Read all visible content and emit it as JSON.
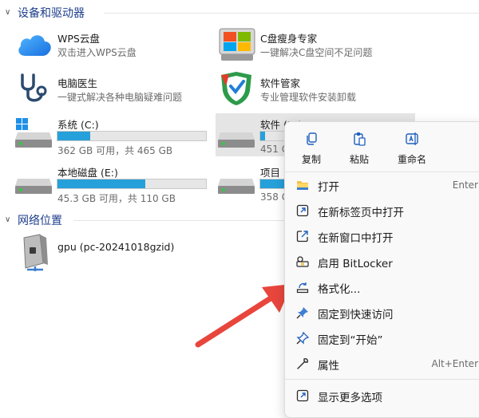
{
  "sections": {
    "devices": "设备和驱动器",
    "network": "网络位置"
  },
  "apps": [
    {
      "title": "WPS云盘",
      "subtitle": "双击进入WPS云盘",
      "icon": "cloud-icon"
    },
    {
      "title": "C盘瘦身专家",
      "subtitle": "一键解决C盘空间不足问题",
      "icon": "disk-cleaner-icon"
    },
    {
      "title": "电脑医生",
      "subtitle": "一键式解决各种电脑疑难问题",
      "icon": "stethoscope-icon"
    },
    {
      "title": "软件管家",
      "subtitle": "专业管理软件安装卸载",
      "icon": "software-manager-icon"
    }
  ],
  "drives": [
    {
      "label": "系统 (C:)",
      "usage": "362 GB 可用，共 465 GB",
      "used_fraction": 0.22
    },
    {
      "label": "软件 (D:)",
      "usage": "451 G",
      "used_fraction": 0.03
    },
    {
      "label": "本地磁盘 (E:)",
      "usage": "45.3 GB 可用，共 110 GB",
      "used_fraction": 0.59
    },
    {
      "label": "项目",
      "usage": "358 G",
      "used_fraction": 0.2
    }
  ],
  "network": {
    "label": "gpu (pc-20241018gzid)",
    "icon": "network-drive-icon"
  },
  "context_menu": {
    "quick_actions": [
      {
        "label": "复制",
        "icon": "copy-icon"
      },
      {
        "label": "粘贴",
        "icon": "paste-icon"
      },
      {
        "label": "重命名",
        "icon": "rename-icon"
      }
    ],
    "items": [
      {
        "label": "打开",
        "shortcut": "Enter",
        "icon": "folder-icon"
      },
      {
        "label": "在新标签页中打开",
        "shortcut": "",
        "icon": "new-tab-icon"
      },
      {
        "label": "在新窗口中打开",
        "shortcut": "",
        "icon": "new-window-icon"
      },
      {
        "label": "启用 BitLocker",
        "shortcut": "",
        "icon": "key-icon"
      },
      {
        "label": "格式化...",
        "shortcut": "",
        "icon": "format-icon"
      },
      {
        "label": "固定到快速访问",
        "shortcut": "",
        "icon": "pin-icon"
      },
      {
        "label": "固定到“开始”",
        "shortcut": "",
        "icon": "pin-start-icon"
      },
      {
        "label": "属性",
        "shortcut": "Alt+Enter",
        "icon": "wrench-icon"
      },
      {
        "label": "显示更多选项",
        "shortcut": "",
        "icon": "more-options-icon"
      }
    ]
  },
  "colors": {
    "accent": "#26a0da",
    "section_title": "#1e3e8c",
    "arrow": "#e8463d"
  }
}
